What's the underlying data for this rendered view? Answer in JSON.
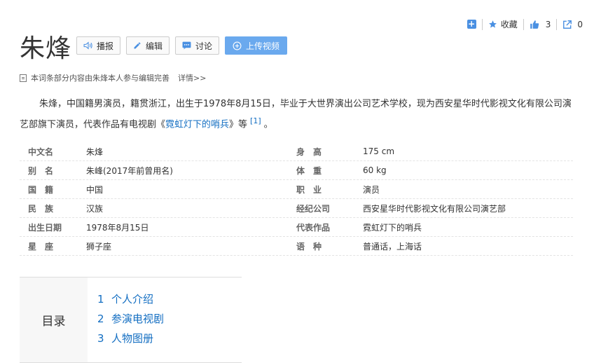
{
  "topbar": {
    "favorite_label": "收藏",
    "like_count": "3",
    "share_count": "0"
  },
  "title": "朱烽",
  "buttons": {
    "play": "播报",
    "edit": "编辑",
    "discuss": "讨论",
    "upload": "上传视频"
  },
  "note": {
    "text": "本词条部分内容由朱烽本人参与编辑完善",
    "more": "详情>>"
  },
  "summary": {
    "part1": "朱烽，中国籍男演员，籍贯浙江，出生于1978年8月15日，毕业于大世界演出公司艺术学校，现为西安星华时代影视文化有限公司演艺部旗下演员，代表作品有电视剧《",
    "link": "霓虹灯下的哨兵",
    "part2": "》等",
    "ref": "[1]",
    "end": "。"
  },
  "info": [
    {
      "k1": "中文名",
      "v1": "朱烽",
      "v1_link": false,
      "k2": "身　高",
      "v2": "175 cm"
    },
    {
      "k1": "别　名",
      "v1": "朱峰(2017年前曾用名)",
      "v1_link": false,
      "k2": "体　重",
      "v2": "60 kg"
    },
    {
      "k1": "国　籍",
      "v1": "中国",
      "v1_link": true,
      "k2": "职　业",
      "v2": "演员"
    },
    {
      "k1": "民　族",
      "v1": "汉族",
      "v1_link": false,
      "k2": "经纪公司",
      "v2": "西安星华时代影视文化有限公司演艺部"
    },
    {
      "k1": "出生日期",
      "v1": "1978年8月15日",
      "v1_link": false,
      "k2": "代表作品",
      "v2": "霓虹灯下的哨兵"
    },
    {
      "k1": "星　座",
      "v1": "狮子座",
      "v1_link": true,
      "k2": "语　种",
      "v2": "普通话，上海话"
    }
  ],
  "toc": {
    "label": "目录",
    "items": [
      {
        "num": "1",
        "text": "个人介绍"
      },
      {
        "num": "2",
        "text": "参演电视剧"
      },
      {
        "num": "3",
        "text": "人物图册"
      }
    ]
  },
  "colors": {
    "link": "#136ec2",
    "accent": "#4a90e2",
    "primary_button": "#6aa9ee"
  }
}
